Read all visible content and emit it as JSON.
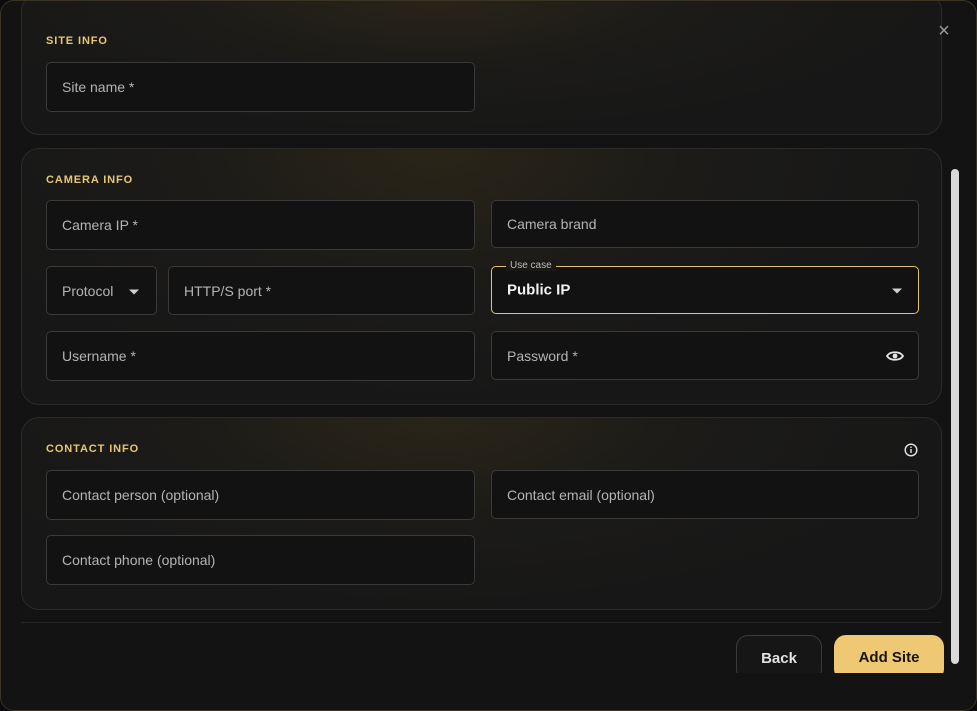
{
  "site_info": {
    "title": "SITE INFO",
    "site_name_placeholder": "Site name *"
  },
  "camera_info": {
    "title": "CAMERA INFO",
    "camera_ip_placeholder": "Camera IP *",
    "camera_brand_placeholder": "Camera brand",
    "protocol_placeholder": "Protocol",
    "port_placeholder": "HTTP/S port *",
    "use_case_label": "Use case",
    "use_case_value": "Public IP",
    "username_placeholder": "Username *",
    "password_placeholder": "Password *"
  },
  "contact_info": {
    "title": "CONTACT INFO",
    "contact_person_placeholder": "Contact person (optional)",
    "contact_email_placeholder": "Contact email (optional)",
    "contact_phone_placeholder": "Contact phone (optional)"
  },
  "actions": {
    "back_label": "Back",
    "add_label": "Add Site",
    "close_glyph": "×"
  },
  "colors": {
    "accent": "#efc873",
    "section_title": "#e8c774",
    "background": "#131313"
  },
  "icons": {
    "close": "close-icon",
    "caret": "chevron-down-icon",
    "password_toggle": "eye-icon",
    "info": "info-icon"
  }
}
